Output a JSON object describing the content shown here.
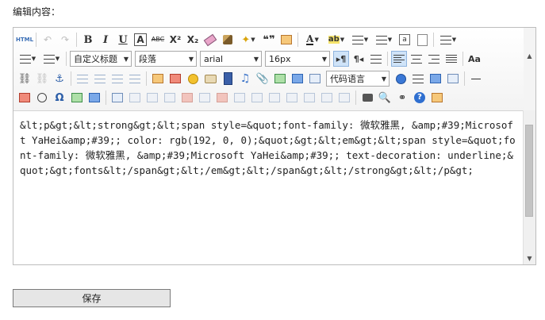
{
  "page": {
    "label": "编辑内容：",
    "save_label": "保存"
  },
  "toolbar": {
    "source_label": "HTML",
    "bold": "B",
    "italic": "I",
    "underline": "U",
    "fontborder": "A",
    "strikethrough": "ABC",
    "superscript": "X²",
    "subscript": "X₂",
    "blockquote": "❝❞",
    "forecolor": "A",
    "backcolor": "ab",
    "symbol": "Ω",
    "help": "?",
    "custom_style": "自定义标题",
    "paragraph": "段落",
    "font_family": "arial",
    "font_size": "16px",
    "code_language": "代码语言"
  },
  "content": {
    "text": "&lt;p&gt;&lt;strong&gt;&lt;span style=&quot;font-family: 微软雅黑, &amp;#39;Microsoft YaHei&amp;#39;; color: rgb(192, 0, 0);&quot;&gt;&lt;em&gt;&lt;span style=&quot;font-family: 微软雅黑, &amp;#39;Microsoft YaHei&amp;#39;; text-decoration: underline;&quot;&gt;fonts&lt;/span&gt;&lt;/em&gt;&lt;/span&gt;&lt;/strong&gt;&lt;/p&gt;"
  },
  "colors": {
    "active_button_bg": "#cfe3f8",
    "toolbar_border": "#d4d4d4"
  }
}
